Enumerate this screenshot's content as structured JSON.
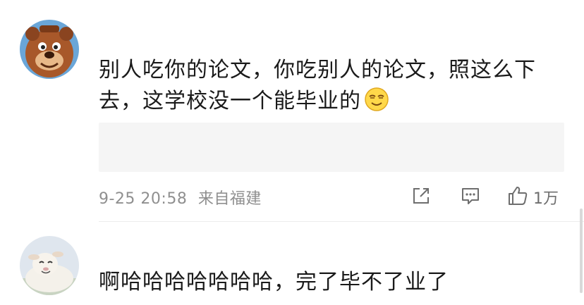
{
  "comments": [
    {
      "avatar_icon": "bear-avatar-icon",
      "text": "别人吃你的论文，你吃别人的论文，照这么下去，这学校没一个能毕业的",
      "emoji_icon": "smirk-emoji-icon",
      "timestamp": "9-25 20:58",
      "source": "来自福建",
      "share_icon": "share-icon",
      "reply_icon": "comment-icon",
      "like_icon": "thumbs-up-icon",
      "like_count": "1万"
    },
    {
      "avatar_icon": "sheep-avatar-icon",
      "text": "啊哈哈哈哈哈哈哈，完了毕不了业了"
    }
  ],
  "colors": {
    "text": "#1a1a1a",
    "meta": "#8f8f8f",
    "quote_bg": "#f5f5f5",
    "divider": "#ececec"
  }
}
